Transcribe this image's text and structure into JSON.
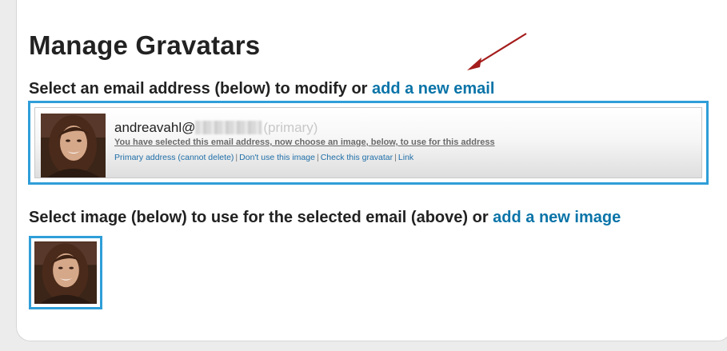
{
  "page": {
    "title": "Manage Gravatars"
  },
  "email_section": {
    "heading": "Select an email address (below) to modify or ",
    "add_link": "add a new email",
    "entry": {
      "email_user": "andreavahl@",
      "primary_tag": "(primary)",
      "notice": "You have selected this email address, now choose an image, below, to use for this address",
      "actions": {
        "primary": "Primary address (cannot delete)",
        "dont_use": "Don't use this image",
        "check": "Check this gravatar",
        "link": "Link"
      }
    }
  },
  "image_section": {
    "heading": "Select image (below) to use for the selected email (above) or ",
    "add_link": "add a new image"
  },
  "colors": {
    "accent": "#2f9ed8",
    "link": "#0a74a8",
    "arrow": "#a51d1d"
  }
}
